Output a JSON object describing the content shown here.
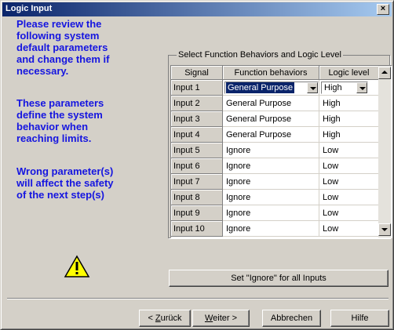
{
  "window": {
    "title": "Logic Input",
    "close_glyph": "×"
  },
  "notes": {
    "review": "Please review the\nfollowing system\ndefault parameters\nand change them if\nnecessary.",
    "define": "These parameters\ndefine the system\nbehavior when\nreaching limits.",
    "wrong": "Wrong parameter(s)\nwill affect the safety\nof the next step(s)"
  },
  "group": {
    "label": "Select Function Behaviors and Logic Level"
  },
  "table": {
    "headers": {
      "signal": "Signal",
      "function": "Function behaviors",
      "logic": "Logic level"
    },
    "rows": [
      {
        "signal": "Input 1",
        "function": "General Purpose",
        "logic": "High"
      },
      {
        "signal": "Input 2",
        "function": "General Purpose",
        "logic": "High"
      },
      {
        "signal": "Input 3",
        "function": "General Purpose",
        "logic": "High"
      },
      {
        "signal": "Input 4",
        "function": "General Purpose",
        "logic": "High"
      },
      {
        "signal": "Input 5",
        "function": "Ignore",
        "logic": "Low"
      },
      {
        "signal": "Input 6",
        "function": "Ignore",
        "logic": "Low"
      },
      {
        "signal": "Input 7",
        "function": "Ignore",
        "logic": "Low"
      },
      {
        "signal": "Input 8",
        "function": "Ignore",
        "logic": "Low"
      },
      {
        "signal": "Input 9",
        "function": "Ignore",
        "logic": "Low"
      },
      {
        "signal": "Input 10",
        "function": "Ignore",
        "logic": "Low"
      }
    ]
  },
  "buttons": {
    "set_ignore": "Set \"Ignore\" for all Inputs",
    "back_prefix": "< ",
    "back_mnemonic": "Z",
    "back_rest": "urück",
    "next_mnemonic": "W",
    "next_rest": "eiter >",
    "cancel": "Abbrechen",
    "help": "Hilfe"
  },
  "icons": {
    "warning": "warning-triangle-icon"
  },
  "colors": {
    "note_text": "#1515e0",
    "title_bar": "#0a246a",
    "selection": "#0a246a",
    "dialog_bg": "#d4d0c8"
  }
}
